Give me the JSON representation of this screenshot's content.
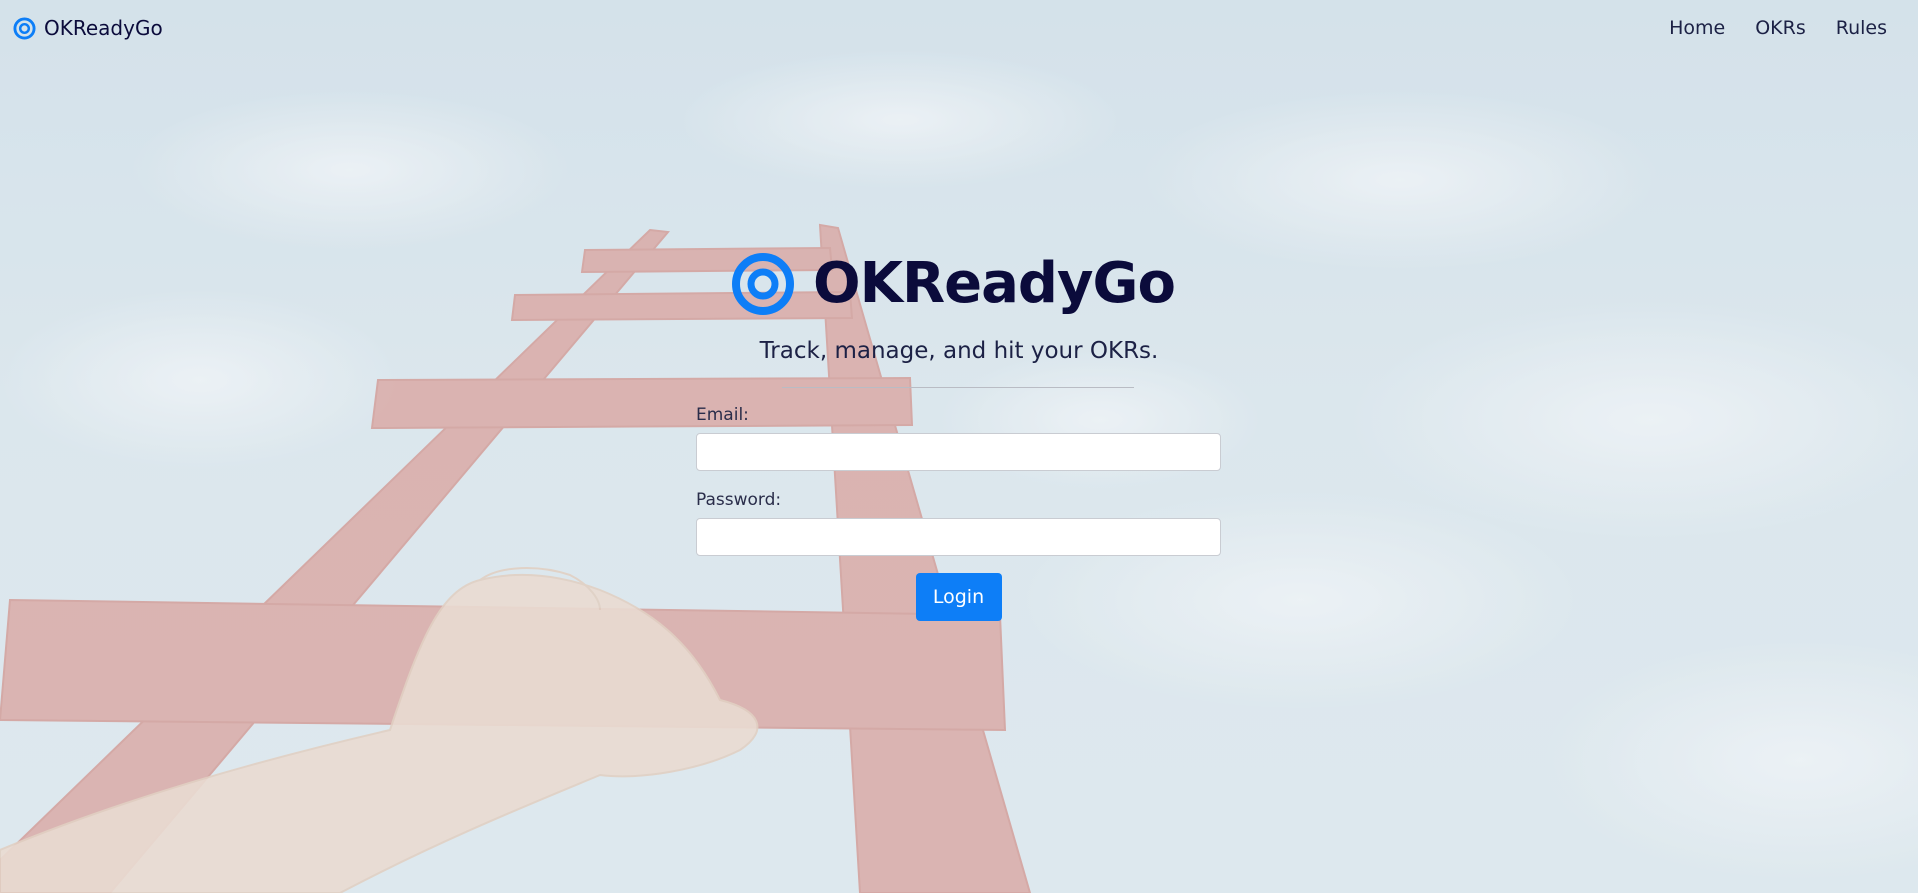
{
  "navbar": {
    "brand_name": "OKReadyGo",
    "brand_icon": "target-icon",
    "links": [
      {
        "label": "Home"
      },
      {
        "label": "OKRs"
      },
      {
        "label": "Rules"
      }
    ]
  },
  "hero": {
    "title": "OKReadyGo",
    "icon": "target-icon",
    "tagline": "Track, manage, and hit your OKRs."
  },
  "login_form": {
    "email_label": "Email:",
    "email_value": "",
    "password_label": "Password:",
    "password_value": "",
    "submit_label": "Login"
  },
  "colors": {
    "accent": "#0d7ef7",
    "text": "#0b0b3b"
  }
}
